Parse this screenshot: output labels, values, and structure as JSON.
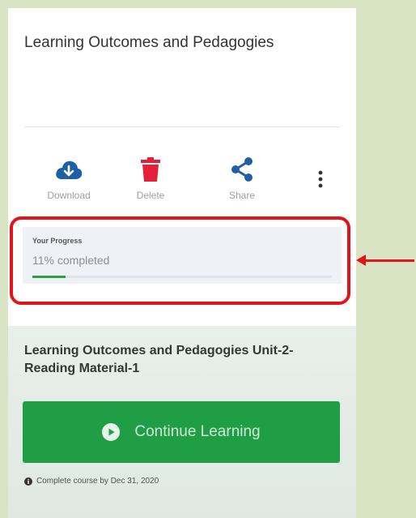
{
  "header": {
    "title": "Learning Outcomes and Pedagogies"
  },
  "actions": [
    {
      "label": "Download",
      "icon": "cloud-download-icon",
      "color": "#1f5fa8"
    },
    {
      "label": "Delete",
      "icon": "trash-icon",
      "color": "#e3203a"
    },
    {
      "label": "Share",
      "icon": "share-icon",
      "color": "#1f5fa8"
    }
  ],
  "more_icon": "more-vertical-icon",
  "progress": {
    "label": "Your Progress",
    "value_text": "11% completed",
    "percent": 11
  },
  "annotation": {
    "color": "#e3131b"
  },
  "course": {
    "title": "Learning Outcomes and Pedagogies Unit-2-Reading Material-1",
    "continue_label": "Continue Learning",
    "deadline": "Complete course by Dec 31, 2020"
  }
}
